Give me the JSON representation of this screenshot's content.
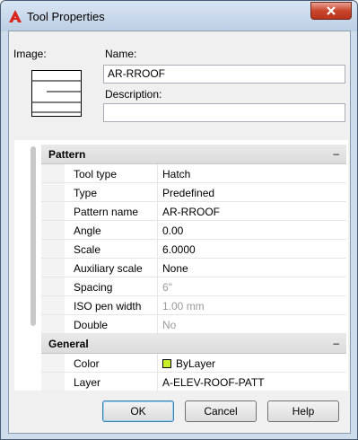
{
  "window": {
    "title": "Tool Properties",
    "close_label": "X"
  },
  "form": {
    "image_label": "Image:",
    "name_label": "Name:",
    "name_value": "AR-RROOF",
    "description_label": "Description:",
    "description_value": ""
  },
  "sections": [
    {
      "title": "Pattern",
      "collapse": "–",
      "rows": [
        {
          "name": "Tool type",
          "value": "Hatch"
        },
        {
          "name": "Type",
          "value": "Predefined"
        },
        {
          "name": "Pattern name",
          "value": "AR-RROOF"
        },
        {
          "name": "Angle",
          "value": "0.00"
        },
        {
          "name": "Scale",
          "value": "6.0000"
        },
        {
          "name": "Auxiliary scale",
          "value": "None"
        },
        {
          "name": "Spacing",
          "value": "6\"",
          "muted": true
        },
        {
          "name": "ISO pen width",
          "value": "1.00 mm",
          "muted": true
        },
        {
          "name": "Double",
          "value": "No",
          "muted": true
        }
      ]
    },
    {
      "title": "General",
      "collapse": "–",
      "rows": [
        {
          "name": "Color",
          "value": "ByLayer",
          "swatch": "#c8f028"
        },
        {
          "name": "Layer",
          "value": "A-ELEV-ROOF-PATT"
        }
      ]
    }
  ],
  "buttons": {
    "ok": "OK",
    "cancel": "Cancel",
    "help": "Help"
  },
  "icons": {
    "app": "autocad-icon",
    "close": "close-icon"
  }
}
